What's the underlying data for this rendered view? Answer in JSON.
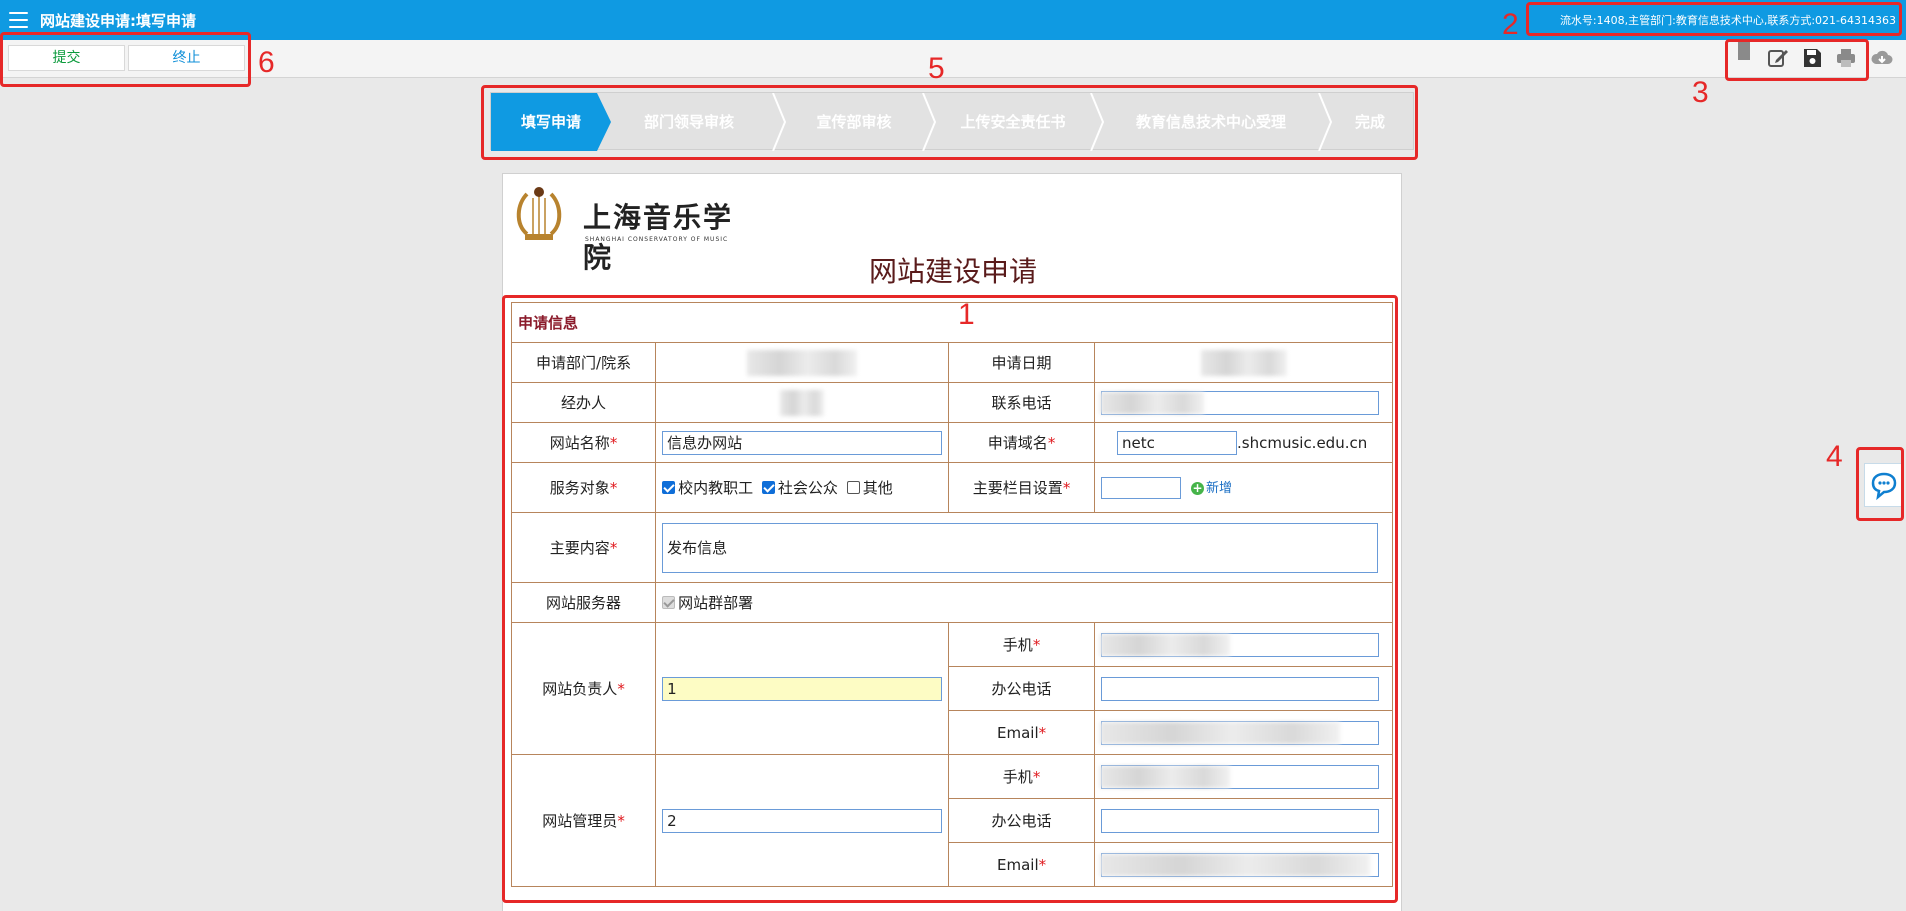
{
  "header": {
    "title": "网站建设申请:填写申请",
    "info": "流水号:1408,主管部门:教育信息技术中心,联系方式:021-64314363"
  },
  "toolbar": {
    "submit_label": "提交",
    "stop_label": "终止",
    "tools": [
      "flag-icon",
      "edit-icon",
      "save-icon",
      "print-icon",
      "cloud-download-icon"
    ]
  },
  "steps": [
    "填写申请",
    "部门领导审核",
    "宣传部审核",
    "上传安全责任书",
    "教育信息技术中心受理",
    "完成"
  ],
  "active_step": 0,
  "document": {
    "logo_text": "上海音乐学院",
    "logo_sub": "SHANGHAI CONSERVATORY OF MUSIC",
    "title": "网站建设申请"
  },
  "form": {
    "section": "申请信息",
    "labels": {
      "dept": "申请部门/院系",
      "date": "申请日期",
      "handler": "经办人",
      "phone": "联系电话",
      "site_name": "网站名称",
      "domain": "申请域名",
      "audience": "服务对象",
      "columns": "主要栏目设置",
      "content": "主要内容",
      "server": "网站服务器",
      "owner": "网站负责人",
      "admin": "网站管理员",
      "mobile": "手机",
      "office": "办公电话",
      "email": "Email"
    },
    "values": {
      "site_name": "信息办网站",
      "domain_prefix": "netc",
      "domain_suffix": ".shcmusic.edu.cn",
      "content": "发布信息",
      "owner": "1",
      "admin": "2"
    },
    "audience_options": [
      {
        "label": "校内教职工",
        "checked": true
      },
      {
        "label": "社会公众",
        "checked": true
      },
      {
        "label": "其他",
        "checked": false
      }
    ],
    "server_option": "网站群部署",
    "add_label": "新增",
    "required_mark": "*"
  },
  "annotations": [
    "1",
    "2",
    "3",
    "4",
    "5",
    "6"
  ],
  "colors": {
    "primary": "#0f9ae2",
    "annotation": "#e62828",
    "border": "#b7855c",
    "section": "#8b1b2b"
  }
}
